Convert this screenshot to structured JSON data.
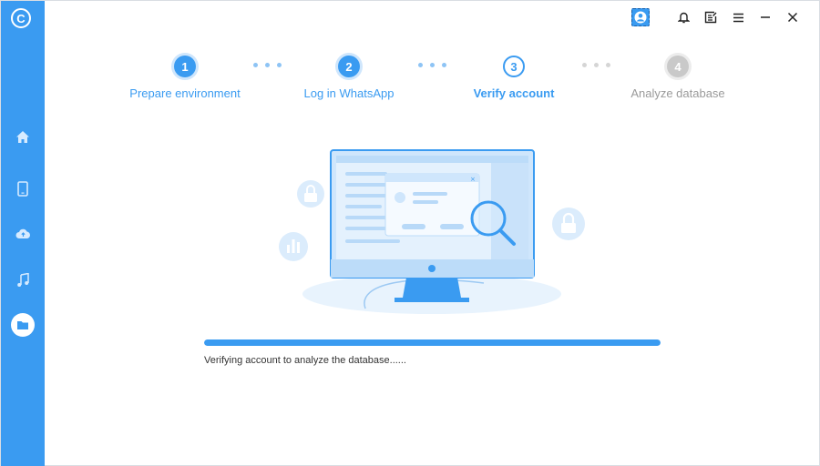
{
  "app": {
    "logo_glyph": "C",
    "accent_color": "#3a9bf1"
  },
  "sidebar": {
    "items": [
      {
        "name": "home",
        "icon": "home-icon"
      },
      {
        "name": "device",
        "icon": "phone-icon"
      },
      {
        "name": "cloud",
        "icon": "cloud-icon"
      },
      {
        "name": "music",
        "icon": "music-icon"
      },
      {
        "name": "files",
        "icon": "folder-icon",
        "active": true
      }
    ]
  },
  "topbar": {
    "icons": [
      "user-icon",
      "bell-icon",
      "edit-icon",
      "menu-icon",
      "minimize-icon",
      "close-icon"
    ]
  },
  "steps": [
    {
      "number": "1",
      "label": "Prepare environment",
      "state": "done"
    },
    {
      "number": "2",
      "label": "Log in WhatsApp",
      "state": "done"
    },
    {
      "number": "3",
      "label": "Verify account",
      "state": "current"
    },
    {
      "number": "4",
      "label": "Analyze database",
      "state": "pending"
    }
  ],
  "progress": {
    "fraction": 1.0,
    "status": "Verifying account to analyze the database......"
  }
}
